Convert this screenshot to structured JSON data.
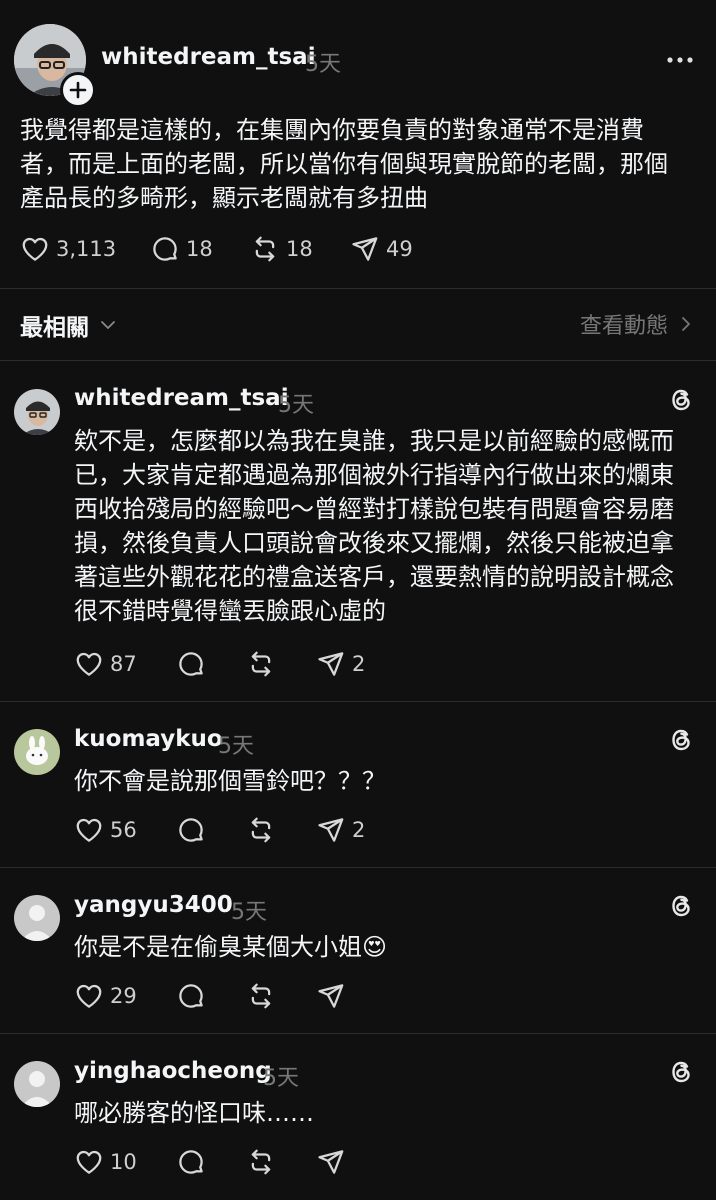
{
  "post": {
    "username": "whitedream_tsai",
    "time": "5天",
    "text_lines": [
      "我覺得都是這樣的，在集團內你要負責的對象通常不是消費",
      "者，而是上面的老闆，所以當你有個與現實脫節的老闆，那個",
      "產品長的多畸形，顯示老闆就有多扭曲"
    ],
    "likes": "3,113",
    "comments": "18",
    "reposts": "18",
    "shares": "49"
  },
  "sort": {
    "label": "最相關",
    "activity_link": "查看動態"
  },
  "replies": [
    {
      "username": "whitedream_tsai",
      "time": "5天",
      "text_lines": [
        "欸不是，怎麼都以為我在臭誰，我只是以前經驗的感慨而",
        "已，大家肯定都遇過為那個被外行指導內行做出來的爛東",
        "西收拾殘局的經驗吧～曾經對打樣說包裝有問題會容易磨",
        "損，然後負責人口頭說會改後來又擺爛，然後只能被迫拿",
        "著這些外觀花花的禮盒送客戶，還要熱情的說明設計概念",
        "很不錯時覺得蠻丟臉跟心虛的"
      ],
      "likes": "87",
      "shares": "2"
    },
    {
      "username": "kuomaykuo",
      "time": "5天",
      "text_lines": [
        "你不會是說那個雪鈴吧？？？"
      ],
      "likes": "56",
      "shares": "2"
    },
    {
      "username": "yangyu3400",
      "time": "5天",
      "text_lines": [
        "你是不是在偷臭某個大小姐😍"
      ],
      "likes": "29",
      "shares": ""
    },
    {
      "username": "yinghaocheong",
      "time": "5天",
      "text_lines": [
        "哪必勝客的怪口味……"
      ],
      "likes": "10",
      "shares": ""
    }
  ]
}
